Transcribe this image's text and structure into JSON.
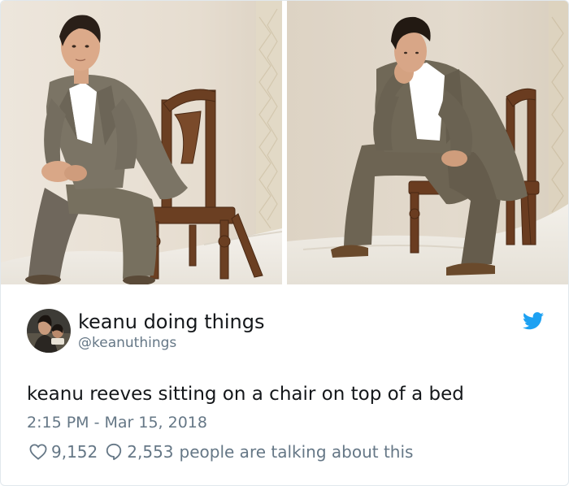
{
  "tweet": {
    "display_name": "keanu doing things",
    "handle": "@keanuthings",
    "text": "keanu reeves sitting on a chair on top of a bed",
    "timestamp": "2:15 PM - Mar 15, 2018",
    "likes": "9,152",
    "replies": "2,553",
    "talking_text": "people are talking about this"
  },
  "icons": {
    "platform": "twitter-bird-icon",
    "like": "heart-icon",
    "reply": "speech-bubble-icon"
  },
  "colors": {
    "brand": "#1da1f2",
    "text": "#14171a",
    "secondary": "#657786",
    "border": "#e1e8ed"
  }
}
